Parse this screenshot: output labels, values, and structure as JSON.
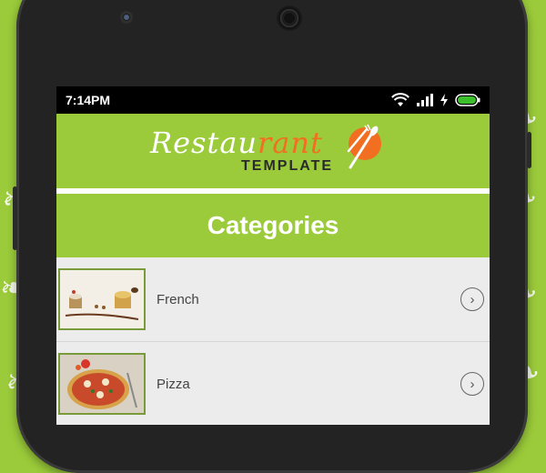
{
  "status_bar": {
    "time": "7:14PM"
  },
  "brand": {
    "word_prefix": "Restau",
    "word_accent": "rant",
    "sub": "TEMPLATE"
  },
  "page": {
    "title": "Categories"
  },
  "categories": [
    {
      "label": "French"
    },
    {
      "label": "Pizza"
    }
  ],
  "colors": {
    "background": "#9bcb3a",
    "accent": "#f26f22",
    "list_bg": "#ececec"
  }
}
